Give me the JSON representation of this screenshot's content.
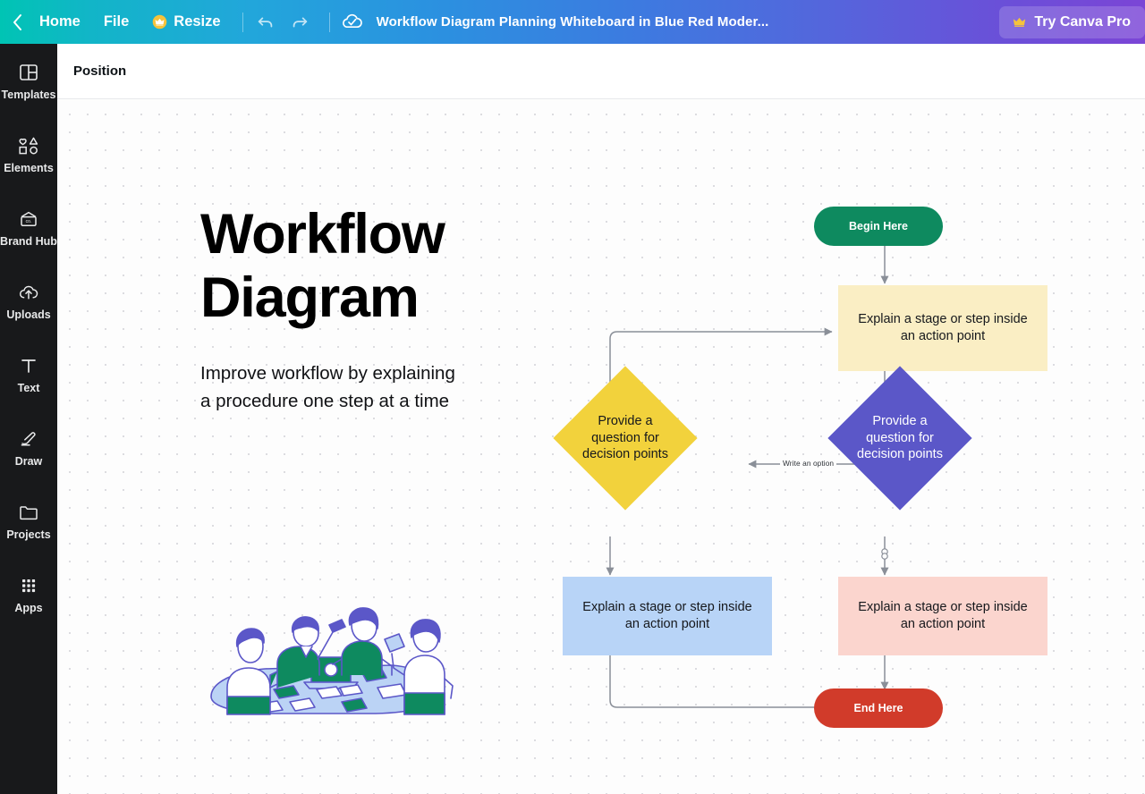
{
  "topbar": {
    "back_icon": "chevron-left-icon",
    "home_label": "Home",
    "file_label": "File",
    "resize_label": "Resize",
    "resize_icon": "crown-icon",
    "undo_icon": "undo-icon",
    "redo_icon": "redo-icon",
    "save_icon": "cloud-check-icon",
    "doc_title": "Workflow Diagram Planning Whiteboard in Blue Red Moder...",
    "pro_label": "Try Canva Pro",
    "pro_icon": "crown-icon"
  },
  "sidebar": {
    "items": [
      {
        "label": "Templates",
        "icon": "templates-icon"
      },
      {
        "label": "Elements",
        "icon": "elements-icon"
      },
      {
        "label": "Brand Hub",
        "icon": "brand-hub-icon"
      },
      {
        "label": "Uploads",
        "icon": "uploads-cloud-icon"
      },
      {
        "label": "Text",
        "icon": "text-icon"
      },
      {
        "label": "Draw",
        "icon": "draw-pen-icon"
      },
      {
        "label": "Projects",
        "icon": "projects-folder-icon"
      },
      {
        "label": "Apps",
        "icon": "apps-grid-icon"
      }
    ]
  },
  "toolbar": {
    "position_label": "Position"
  },
  "canvas": {
    "headline_line1": "Workflow",
    "headline_line2": "Diagram",
    "subtitle": "Improve workflow by explaining a procedure one step at a time",
    "illustration_name": "team-meeting-illustration"
  },
  "chart_data": {
    "type": "diagram",
    "title": "Workflow Diagram",
    "nodes": [
      {
        "id": "begin",
        "label": "Begin Here",
        "shape": "pill",
        "fill": "#0E8A5F",
        "text_color": "#FFFFFF"
      },
      {
        "id": "action_top",
        "label": "Explain a stage or step inside an action point",
        "shape": "rect",
        "fill": "#FAEEC4",
        "text_color": "#16181C"
      },
      {
        "id": "decision_r",
        "label": "Provide a question for decision points",
        "shape": "diamond",
        "fill": "#5B57C8",
        "text_color": "#FFFFFF"
      },
      {
        "id": "decision_l",
        "label": "Provide a question for decision points",
        "shape": "diamond",
        "fill": "#F2D23C",
        "text_color": "#16181C"
      },
      {
        "id": "action_left",
        "label": "Explain a stage or step inside an action point",
        "shape": "rect",
        "fill": "#B8D4F7",
        "text_color": "#16181C"
      },
      {
        "id": "action_right",
        "label": "Explain a stage or step inside an action point",
        "shape": "rect",
        "fill": "#FBD5CE",
        "text_color": "#16181C"
      },
      {
        "id": "end",
        "label": "End Here",
        "shape": "pill",
        "fill": "#D13B2A",
        "text_color": "#FFFFFF"
      }
    ],
    "edges": [
      {
        "from": "begin",
        "to": "action_top",
        "label": ""
      },
      {
        "from": "action_top",
        "to": "decision_r",
        "label": ""
      },
      {
        "from": "decision_r",
        "to": "decision_l",
        "label": "Write an option"
      },
      {
        "from": "decision_l",
        "to": "action_top",
        "label": ""
      },
      {
        "from": "decision_l",
        "to": "action_left",
        "label": ""
      },
      {
        "from": "decision_r",
        "to": "action_right",
        "label": ""
      },
      {
        "from": "action_right",
        "to": "end",
        "label": ""
      },
      {
        "from": "action_left",
        "to": "end",
        "label": ""
      }
    ],
    "connector_color": "#8A8F98"
  }
}
